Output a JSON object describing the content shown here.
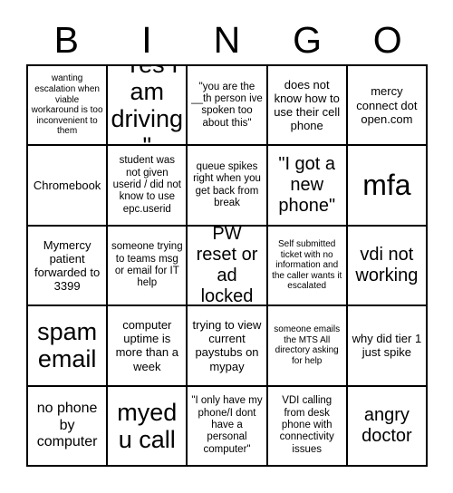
{
  "card": {
    "title_letters": [
      "B",
      "I",
      "N",
      "G",
      "O"
    ],
    "background_color": "#ffffff",
    "line_color": "#000000",
    "text_color": "#000000"
  },
  "grid": {
    "columns": 5,
    "rows": 5,
    "cells": [
      {
        "text": "wanting escalation when viable workaround is too inconvenient to them",
        "size": "fs-xs"
      },
      {
        "text": "\"Yes I am driving\"",
        "size": "fs-xxl"
      },
      {
        "text": "\"you are the __th person ive spoken too about this\"",
        "size": "fs-sm"
      },
      {
        "text": "does not know how to use their cell phone",
        "size": "fs-md"
      },
      {
        "text": "mercy connect dot open.com",
        "size": "fs-md"
      },
      {
        "text": "Chromebook",
        "size": "fs-md"
      },
      {
        "text": "student was not given userid / did not know to use epc.userid",
        "size": "fs-sm"
      },
      {
        "text": "queue spikes right when you get back from break",
        "size": "fs-sm"
      },
      {
        "text": "\"I got a new phone\"",
        "size": "fs-xl"
      },
      {
        "text": "mfa",
        "size": "fs-huge"
      },
      {
        "text": "Mymercy patient forwarded to 3399",
        "size": "fs-md"
      },
      {
        "text": "someone trying to teams msg or email for IT help",
        "size": "fs-sm"
      },
      {
        "text": "PW reset or ad locked",
        "size": "fs-xl"
      },
      {
        "text": "Self submitted ticket with no information and the caller wants it escalated",
        "size": "fs-xs"
      },
      {
        "text": "vdi not working",
        "size": "fs-xl"
      },
      {
        "text": "spam email",
        "size": "fs-xxl"
      },
      {
        "text": "computer uptime is more than a week",
        "size": "fs-md"
      },
      {
        "text": "trying to view current paystubs on mypay",
        "size": "fs-md"
      },
      {
        "text": "someone emails the MTS All directory asking for help",
        "size": "fs-xs"
      },
      {
        "text": "why did tier 1 just spike",
        "size": "fs-md"
      },
      {
        "text": "no phone by computer",
        "size": "fs-lg"
      },
      {
        "text": "myedu call",
        "size": "fs-xxl"
      },
      {
        "text": "\"I only have my phone/I dont have a personal computer\"",
        "size": "fs-sm"
      },
      {
        "text": "VDI calling from desk phone with connectivity issues",
        "size": "fs-sm"
      },
      {
        "text": "angry doctor",
        "size": "fs-xl"
      }
    ]
  }
}
